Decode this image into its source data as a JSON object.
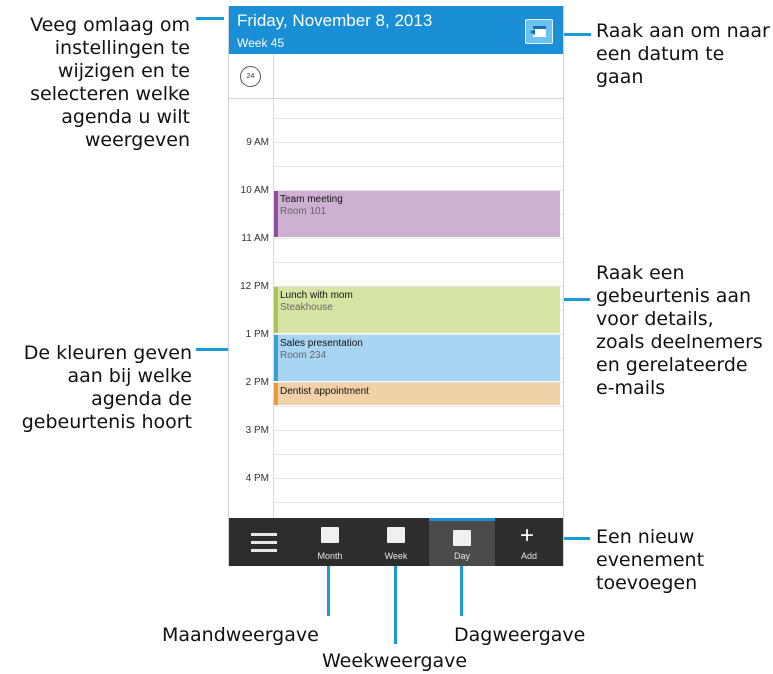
{
  "header": {
    "title": "Friday, November 8, 2013",
    "week": "Week 45",
    "goto_icon": "calendar-jump-icon"
  },
  "allday": {
    "icon": "clock-24-icon",
    "icon_label": "24"
  },
  "hours": [
    "9 AM",
    "10 AM",
    "11 AM",
    "12 PM",
    "1 PM",
    "2 PM",
    "3 PM",
    "4 PM"
  ],
  "events": [
    {
      "title": "Team meeting",
      "location": "Room 101",
      "bg": "#cdb0d2",
      "bar": "#8e4f9e"
    },
    {
      "title": "Lunch with mom",
      "location": "Steakhouse",
      "bg": "#d6e5a4",
      "bar": "#a8c55a"
    },
    {
      "title": "Sales presentation",
      "location": "Room 234",
      "bg": "#a8d6f2",
      "bar": "#3a9fd8"
    },
    {
      "title": "Dentist appointment",
      "location": "",
      "bg": "#f1d1a8",
      "bar": "#e89a3c"
    }
  ],
  "footer": {
    "menu_icon": "hamburger-menu-icon",
    "month": "Month",
    "week": "Week",
    "day": "Day",
    "add": "Add",
    "active": "Day"
  },
  "callouts": {
    "top_left": [
      "Veeg omlaag om",
      "instellingen te",
      "wijzigen en te",
      "selecteren welke",
      "agenda u wilt",
      "weergeven"
    ],
    "top_right": [
      "Raak aan om naar",
      "een datum te",
      "gaan"
    ],
    "mid_right": [
      "Raak een",
      "gebeurtenis aan",
      "voor details,",
      "zoals deelnemers",
      "en gerelateerde",
      "e-mails"
    ],
    "mid_left": [
      "De kleuren geven",
      "aan bij welke",
      "agenda de",
      "gebeurtenis hoort"
    ],
    "bottom_right": [
      "Een nieuw",
      "evenement",
      "toevoegen"
    ],
    "month_label": "Maandweergave",
    "week_label": "Weekweergave",
    "day_label": "Dagweergave"
  },
  "colors": {
    "accent": "#1b8fd6",
    "callout_line": "#1a9ad6"
  }
}
